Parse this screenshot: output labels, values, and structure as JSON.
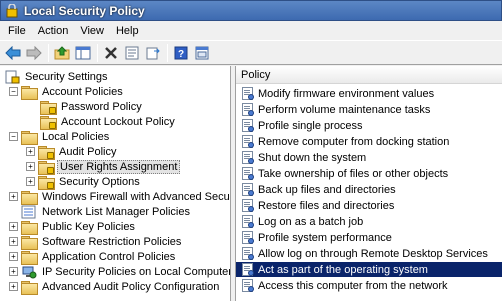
{
  "window": {
    "title": "Local Security Policy"
  },
  "menu": {
    "items": [
      "File",
      "Action",
      "View",
      "Help"
    ]
  },
  "toolbar": {
    "buttons": [
      "back-arrow-icon",
      "forward-arrow-icon",
      "up-folder-icon",
      "show-hide-tree-icon",
      "delete-icon",
      "properties-icon",
      "export-icon",
      "help-icon",
      "console-icon"
    ]
  },
  "tree": {
    "root": "Security Settings",
    "account_policies": "Account Policies",
    "password_policy": "Password Policy",
    "account_lockout_policy": "Account Lockout Policy",
    "local_policies": "Local Policies",
    "audit_policy": "Audit Policy",
    "user_rights_assignment": "User Rights Assignment",
    "security_options": "Security Options",
    "windows_firewall": "Windows Firewall with Advanced Security",
    "network_list_manager": "Network List Manager Policies",
    "public_key_policies": "Public Key Policies",
    "software_restriction": "Software Restriction Policies",
    "application_control": "Application Control Policies",
    "ip_security": "IP Security Policies on Local Computer",
    "advanced_audit": "Advanced Audit Policy Configuration"
  },
  "list": {
    "header": "Policy",
    "items": [
      "Modify firmware environment values",
      "Perform volume maintenance tasks",
      "Profile single process",
      "Remove computer from docking station",
      "Shut down the system",
      "Take ownership of files or other objects",
      "Back up files and directories",
      "Restore files and directories",
      "Log on as a batch job",
      "Profile system performance",
      "Allow log on through Remote Desktop Services",
      "Act as part of the operating system",
      "Access this computer from the network"
    ],
    "selected_index": 11
  },
  "colors": {
    "title_bar": "#3d6ab0",
    "selection": "#0a246a"
  }
}
